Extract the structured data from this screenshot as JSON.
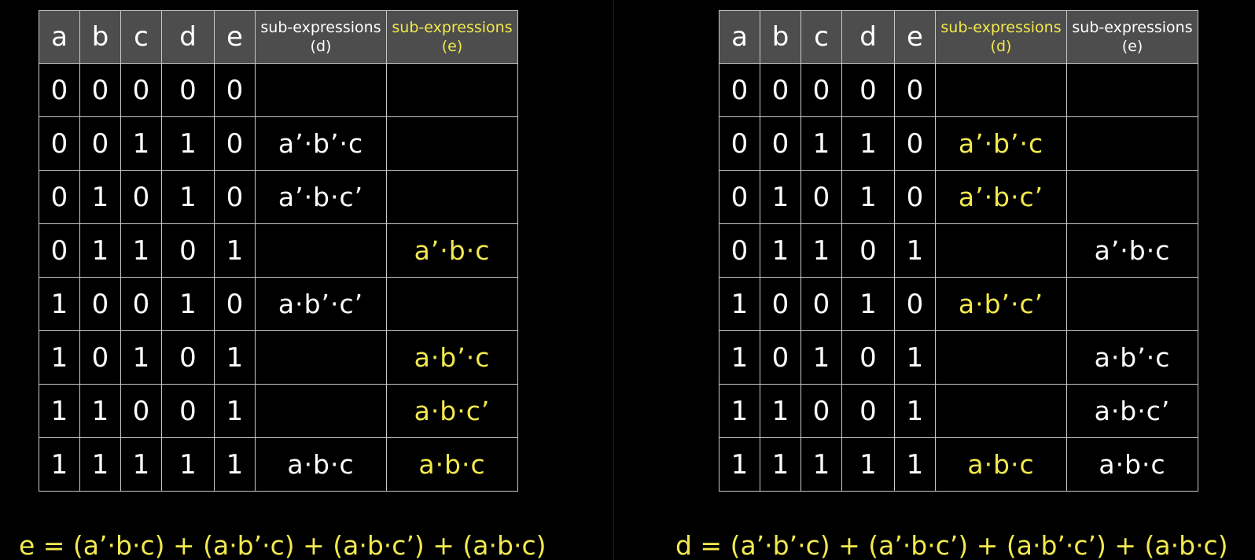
{
  "colors": {
    "background": "#000000",
    "header_bg": "#4d4d4d",
    "grid": "#c8c8c8",
    "text": "#ffffff",
    "highlight": "#f2e94e"
  },
  "left": {
    "headers": [
      "a",
      "b",
      "c",
      "d",
      "e"
    ],
    "sub_d": {
      "line1": "sub-expressions",
      "line2": "(d)"
    },
    "sub_e": {
      "line1": "sub-expressions",
      "line2": "(e)"
    },
    "highlighted_column": "e",
    "rows": [
      {
        "bits": [
          "0",
          "0",
          "0",
          "0",
          "0"
        ],
        "d": "",
        "e": ""
      },
      {
        "bits": [
          "0",
          "0",
          "1",
          "1",
          "0"
        ],
        "d": "a’·b’·c",
        "e": ""
      },
      {
        "bits": [
          "0",
          "1",
          "0",
          "1",
          "0"
        ],
        "d": "a’·b·c’",
        "e": ""
      },
      {
        "bits": [
          "0",
          "1",
          "1",
          "0",
          "1"
        ],
        "d": "",
        "e": "a’·b·c"
      },
      {
        "bits": [
          "1",
          "0",
          "0",
          "1",
          "0"
        ],
        "d": "a·b’·c’",
        "e": ""
      },
      {
        "bits": [
          "1",
          "0",
          "1",
          "0",
          "1"
        ],
        "d": "",
        "e": "a·b’·c"
      },
      {
        "bits": [
          "1",
          "1",
          "0",
          "0",
          "1"
        ],
        "d": "",
        "e": "a·b·c’"
      },
      {
        "bits": [
          "1",
          "1",
          "1",
          "1",
          "1"
        ],
        "d": "a·b·c",
        "e": "a·b·c"
      }
    ],
    "formula": "e = (a’·b·c) + (a·b’·c) + (a·b·c’) + (a·b·c)"
  },
  "right": {
    "headers": [
      "a",
      "b",
      "c",
      "d",
      "e"
    ],
    "sub_d": {
      "line1": "sub-expressions",
      "line2": "(d)"
    },
    "sub_e": {
      "line1": "sub-expressions",
      "line2": "(e)"
    },
    "highlighted_column": "d",
    "rows": [
      {
        "bits": [
          "0",
          "0",
          "0",
          "0",
          "0"
        ],
        "d": "",
        "e": ""
      },
      {
        "bits": [
          "0",
          "0",
          "1",
          "1",
          "0"
        ],
        "d": "a’·b’·c",
        "e": ""
      },
      {
        "bits": [
          "0",
          "1",
          "0",
          "1",
          "0"
        ],
        "d": "a’·b·c’",
        "e": ""
      },
      {
        "bits": [
          "0",
          "1",
          "1",
          "0",
          "1"
        ],
        "d": "",
        "e": "a’·b·c"
      },
      {
        "bits": [
          "1",
          "0",
          "0",
          "1",
          "0"
        ],
        "d": "a·b’·c’",
        "e": ""
      },
      {
        "bits": [
          "1",
          "0",
          "1",
          "0",
          "1"
        ],
        "d": "",
        "e": "a·b’·c"
      },
      {
        "bits": [
          "1",
          "1",
          "0",
          "0",
          "1"
        ],
        "d": "",
        "e": "a·b·c’"
      },
      {
        "bits": [
          "1",
          "1",
          "1",
          "1",
          "1"
        ],
        "d": "a·b·c",
        "e": "a·b·c"
      }
    ],
    "formula": "d = (a’·b’·c) + (a’·b·c’) + (a·b’·c’) + (a·b·c)"
  }
}
